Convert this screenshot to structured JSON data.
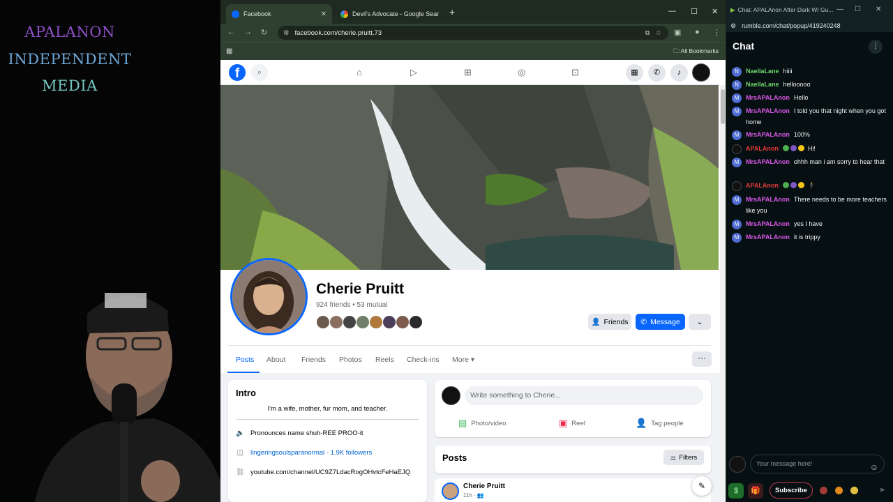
{
  "overlay": {
    "logo_lines": [
      "APALANON",
      "INDEPENDENT",
      "MEDIA"
    ]
  },
  "browser": {
    "tabs": [
      {
        "title": "Facebook",
        "icon": "facebook-favicon",
        "active": true
      },
      {
        "title": "Devil's Advocate - Google Sear",
        "icon": "google-favicon",
        "active": false
      }
    ],
    "address": "facebook.com/cherie.pruitt.73",
    "bookmarks_label": "All Bookmarks"
  },
  "profile": {
    "name": "Cherie Pruitt",
    "friends_summary": "924 friends • 53 mutual",
    "buttons": {
      "friends": "Friends",
      "message": "Message"
    },
    "tabs": [
      "Posts",
      "About",
      "Friends",
      "Photos",
      "Reels",
      "Check-ins",
      "More ▾"
    ],
    "intro": {
      "title": "Intro",
      "bio": "I'm a wife, mother, fur mom, and teacher.",
      "pronounce": "Pronounces name shuh-REE PROO-it",
      "instagram": "lingeringsoulsparanormal · 1.9K followers",
      "link": "youtube.com/channel/UC9Z7LdacRogOHvtcFeHaEJQ"
    },
    "composer": {
      "placeholder": "Write something to Cherie...",
      "actions": [
        "Photo/video",
        "Reel",
        "Tag people"
      ]
    },
    "posts": {
      "title": "Posts",
      "filters": "Filters",
      "first_author": "Cherie Pruitt",
      "first_time": "11h ·"
    }
  },
  "chat": {
    "window_title": "Chat: APALAnon After Dark W/ Gu...",
    "url": "rumble.com/chat/popup/419240248",
    "header": "Chat",
    "messages": [
      {
        "user": "NaellaLane",
        "text": "hiiii",
        "style": "naella"
      },
      {
        "user": "NaellaLane",
        "text": "hellooooo",
        "style": "naella"
      },
      {
        "user": "MrsAPALAnon",
        "text": "Hello",
        "style": "mrs"
      },
      {
        "user": "MrsAPALAnon",
        "text": "I told you that night when you got home",
        "style": "mrs"
      },
      {
        "user": "MrsAPALAnon",
        "text": "100%",
        "style": "mrs"
      },
      {
        "user": "APALAnon",
        "text": "Hi!",
        "style": "apal"
      },
      {
        "user": "MrsAPALAnon",
        "text": "ohhh man i am sorry to hear that",
        "style": "mrs"
      },
      {
        "user": "APALAnon",
        "text": "",
        "style": "apal"
      },
      {
        "user": "MrsAPALAnon",
        "text": "There needs to be more teachers like you",
        "style": "mrs"
      },
      {
        "user": "MrsAPALAnon",
        "text": "yes I have",
        "style": "mrs"
      },
      {
        "user": "MrsAPALAnon",
        "text": "it is trippy",
        "style": "mrs"
      }
    ],
    "input_placeholder": "Your message here!",
    "subscribe_label": "Subscribe"
  },
  "colors": {
    "facebook_blue": "#0866ff",
    "chat_user_naella": "#70d36e",
    "chat_user_mrs": "#d957e6",
    "chat_user_apal": "#e23a3a"
  }
}
